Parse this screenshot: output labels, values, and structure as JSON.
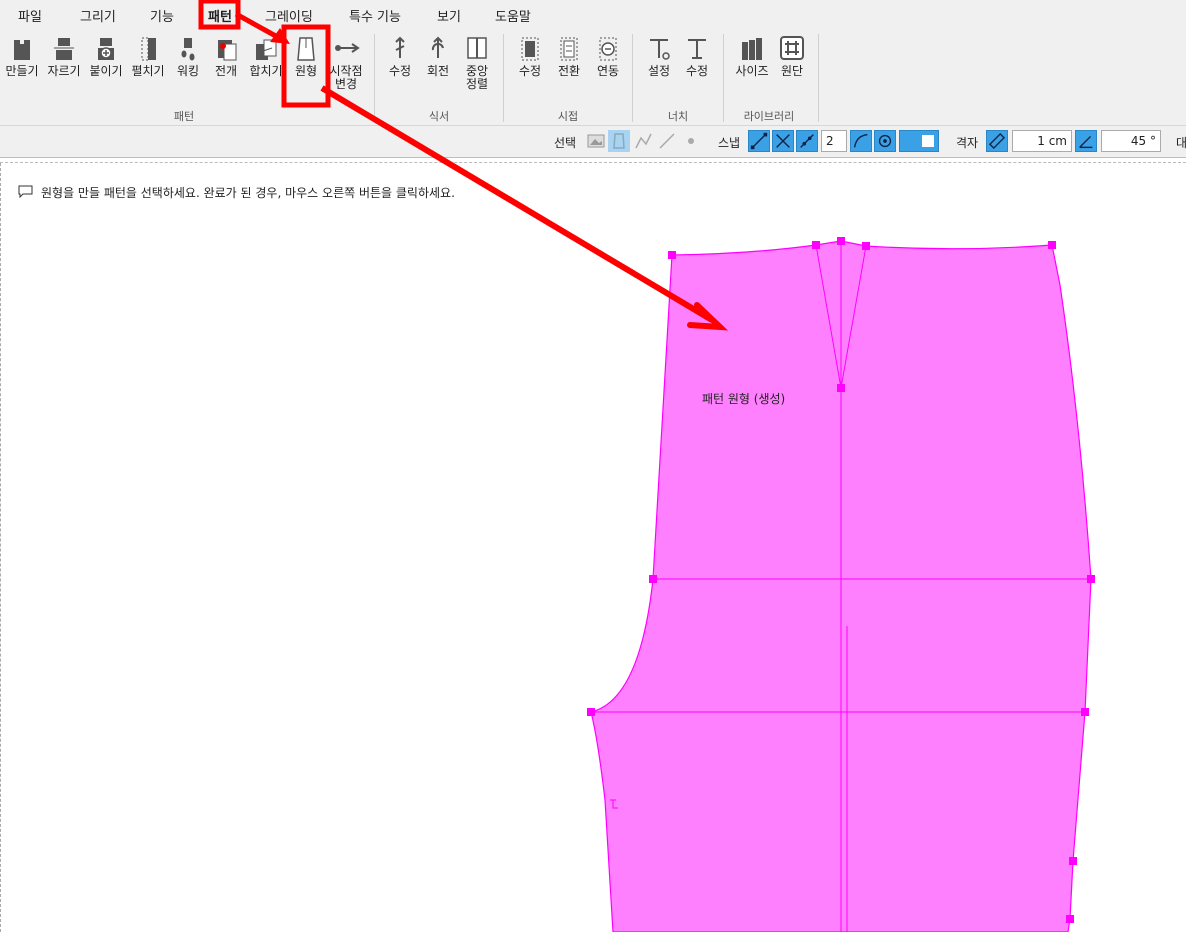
{
  "menu": {
    "items": [
      "파일",
      "그리기",
      "기능",
      "패턴",
      "그레이딩",
      "특수 기능",
      "보기",
      "도움말"
    ],
    "active_index": 3
  },
  "ribbon": {
    "pattern_group": {
      "label": "패턴",
      "tools": [
        "만들기",
        "자르기",
        "붙이기",
        "펼치기",
        "워킹",
        "전개",
        "합치기",
        "원형",
        "시작점",
        "변경"
      ]
    },
    "seam_group": {
      "label": "식서",
      "tools": [
        "수정",
        "회전",
        "중앙",
        "정렬"
      ]
    },
    "sewing_group": {
      "label": "시접",
      "tools": [
        "수정",
        "전환",
        "연동"
      ]
    },
    "notch_group": {
      "label": "너치",
      "tools": [
        "설정",
        "수정"
      ]
    },
    "library_group": {
      "label": "라이브러리",
      "tools": [
        "사이즈",
        "원단"
      ]
    }
  },
  "options": {
    "select_label": "선택",
    "snap_label": "스냅",
    "snap_value": "2",
    "grid_label": "격자",
    "grid_value": "1 cm",
    "angle_value": "45 °",
    "right_cut_label": "대"
  },
  "canvas": {
    "hint": "원형을 만들 패턴을 선택하세요. 완료가 된 경우, 마우스 오른쪽 버튼을 클릭하세요.",
    "pattern_label": "패턴 원형 (생성)",
    "pattern_color": "#ff80ff",
    "pattern_stroke": "#ff00ff"
  },
  "annotation_color": "#ff0000",
  "icons": {
    "make": "pattern-make-icon",
    "cut": "pattern-cut-icon",
    "attach": "pattern-attach-icon",
    "unfold": "pattern-unfold-icon",
    "walk": "pattern-walk-icon",
    "expand": "pattern-expand-icon",
    "merge": "pattern-merge-icon",
    "prototype": "pattern-prototype-icon",
    "start_point": "start-point-icon"
  }
}
